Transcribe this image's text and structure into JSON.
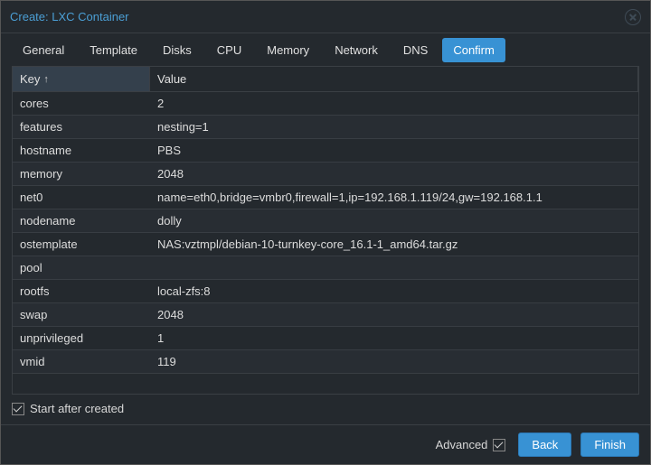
{
  "window": {
    "title": "Create: LXC Container"
  },
  "tabs": [
    {
      "label": "General",
      "active": false
    },
    {
      "label": "Template",
      "active": false
    },
    {
      "label": "Disks",
      "active": false
    },
    {
      "label": "CPU",
      "active": false
    },
    {
      "label": "Memory",
      "active": false
    },
    {
      "label": "Network",
      "active": false
    },
    {
      "label": "DNS",
      "active": false
    },
    {
      "label": "Confirm",
      "active": true
    }
  ],
  "grid": {
    "columns": {
      "key": "Key",
      "value": "Value",
      "sort_indicator": "↑"
    },
    "rows": [
      {
        "key": "cores",
        "value": "2"
      },
      {
        "key": "features",
        "value": "nesting=1"
      },
      {
        "key": "hostname",
        "value": "PBS"
      },
      {
        "key": "memory",
        "value": "2048"
      },
      {
        "key": "net0",
        "value": "name=eth0,bridge=vmbr0,firewall=1,ip=192.168.1.119/24,gw=192.168.1.1"
      },
      {
        "key": "nodename",
        "value": "dolly"
      },
      {
        "key": "ostemplate",
        "value": "NAS:vztmpl/debian-10-turnkey-core_16.1-1_amd64.tar.gz"
      },
      {
        "key": "pool",
        "value": ""
      },
      {
        "key": "rootfs",
        "value": "local-zfs:8"
      },
      {
        "key": "swap",
        "value": "2048"
      },
      {
        "key": "unprivileged",
        "value": "1"
      },
      {
        "key": "vmid",
        "value": "119"
      }
    ]
  },
  "options": {
    "start_after_label": "Start after created",
    "start_after_checked": true,
    "advanced_label": "Advanced",
    "advanced_checked": true
  },
  "buttons": {
    "back": "Back",
    "finish": "Finish"
  }
}
